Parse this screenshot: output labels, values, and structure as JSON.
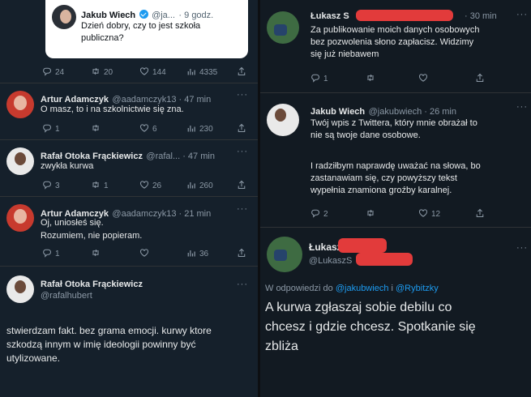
{
  "left": {
    "quote": {
      "name": "Jakub Wiech",
      "handle": "@ja...",
      "time": "· 9 godz.",
      "text_line1": "Dzień dobry, czy to jest szkoła",
      "text_line2": "publiczna?"
    },
    "quote_actions": {
      "replies": "24",
      "retweets": "20",
      "likes": "144",
      "views": "4335"
    },
    "tweets": [
      {
        "name": "Artur Adamczyk",
        "handle": "@aadamczyk13 · 47 min",
        "text": "O masz, to i na szkolnictwie się zna.",
        "replies": "1",
        "retweets": "",
        "likes": "6",
        "views": "230"
      },
      {
        "name": "Rafał Otoka Frąckiewicz",
        "handle": "@rafal... · 47 min",
        "text": "zwykła kurwa",
        "replies": "3",
        "retweets": "1",
        "likes": "26",
        "views": "260"
      },
      {
        "name": "Artur Adamczyk",
        "handle": "@aadamczyk13 · 21 min",
        "text_line1": "Oj, uniosłeś się.",
        "text_line2": "Rozumiem, nie popieram.",
        "replies": "1",
        "retweets": "",
        "likes": "",
        "views": "36"
      }
    ],
    "main_tweet": {
      "name": "Rafał Otoka Frąckiewicz",
      "handle": "@rafalhubert",
      "line1": "stwierdzam fakt. bez grama emocji. kurwy ktore",
      "line2": "szkodzą innym w imię ideologii powinny być",
      "line3": "utylizowane."
    }
  },
  "right": {
    "tweet1": {
      "name": "Łukasz S",
      "time": "· 30 min",
      "line1": "Za publikowanie moich danych osobowych",
      "line2": "bez pozwolenia słono zapłacisz. Widzimy",
      "line3": "się już niebawem",
      "replies": "1"
    },
    "tweet2": {
      "name": "Jakub Wiech",
      "handle": "@jakubwiech · 26 min",
      "line1": "Twój wpis z Twittera, który mnie obrażał to",
      "line2": "nie są twoje dane osobowe.",
      "line3": "I radziłbym naprawdę uważać na słowa, bo",
      "line4": "zastanawiam się, czy powyższy tekst",
      "line5": "wypełnia znamiona groźby karalnej.",
      "replies": "2",
      "likes": "12"
    },
    "main_tweet": {
      "name": "Łukasz",
      "handle": "@LukaszS",
      "reply_prefix": "W odpowiedzi do",
      "reply_user1": "@jakubwiech",
      "reply_and": "i",
      "reply_user2": "@Rybitzky",
      "line1": "A kurwa zgłaszaj sobie debilu co",
      "line2": "chcesz i gdzie chcesz. Spotkanie się",
      "line3": "zbliża"
    }
  },
  "more_label": "···",
  "colors": {
    "background": "#15202b",
    "accent": "#1d9bf0",
    "secondary_text": "#8b98a5",
    "redaction": "#e23b3b"
  },
  "icons": [
    "reply-icon",
    "retweet-icon",
    "like-icon",
    "views-icon",
    "share-icon",
    "more-icon",
    "verified-icon"
  ]
}
